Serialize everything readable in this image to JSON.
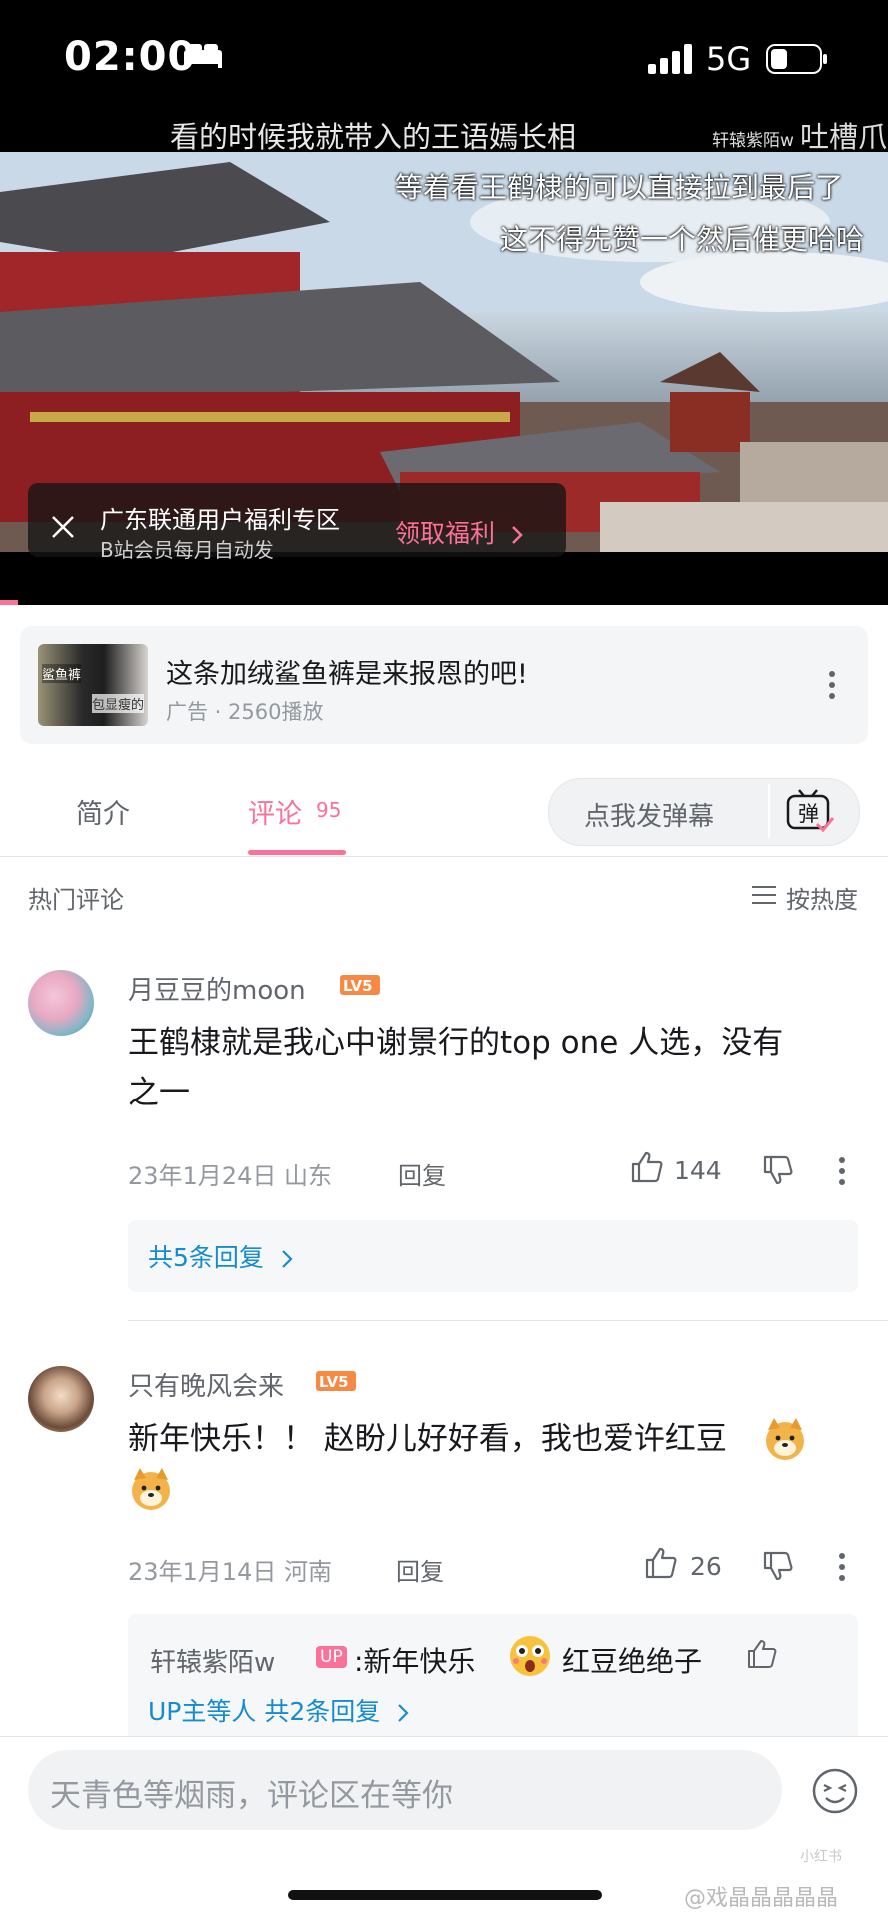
{
  "status_bar": {
    "time": "02:00",
    "network": "5G"
  },
  "video": {
    "danmaku": [
      "看的时候我就带入的王语嫣长相",
      "等着看王鹤棣的可以直接拉到最后了",
      "这不得先赞一个然后催更哈哈",
      "轩辕紫陌w",
      "吐槽爪"
    ],
    "promo": {
      "title": "广东联通用户福利专区",
      "subtitle": "B站会员每月自动发",
      "cta": "领取福利"
    }
  },
  "ad": {
    "thumb_text_1": "鲨鱼裤",
    "thumb_text_2": "包显瘦的",
    "title": "这条加绒鲨鱼裤是来报恩的吧!",
    "meta": "广告 · 2560播放"
  },
  "tabs": {
    "intro": "简介",
    "comments": "评论",
    "comments_count": "95",
    "danmaku_placeholder": "点我发弹幕",
    "danmaku_button": "弹"
  },
  "comments_section": {
    "title": "热门评论",
    "sort": "按热度"
  },
  "comments": [
    {
      "user": "月豆豆的moon",
      "level": "LV5",
      "text_line1": "王鹤棣就是我心中谢景行的top one 人选，没有",
      "text_line2": "之一",
      "date_location": "23年1月24日 山东",
      "reply": "回复",
      "likes": "144",
      "replies_link": "共5条回复"
    },
    {
      "user": "只有晚风会来",
      "level": "LV5",
      "text_line1": "新年快乐！！ 赵盼儿好好看，我也爱许红豆",
      "date_location": "23年1月14日 河南",
      "reply": "回复",
      "likes": "26",
      "sub_reply": {
        "user": "轩辕紫陌w",
        "badge": "UP",
        "text1": ":新年快乐",
        "text2": "红豆绝绝子"
      },
      "replies_link": "UP主等人 共2条回复"
    }
  ],
  "bottom": {
    "input_placeholder": "天青色等烟雨，评论区在等你",
    "watermark_small": "小红书",
    "watermark": "@戏晶晶晶晶晶"
  },
  "colors": {
    "accent_pink": "#fb7299",
    "link_blue": "#178bcf",
    "level_orange": "#f68a45"
  },
  "icons": [
    "sleep-icon",
    "signal-icon",
    "battery-icon",
    "close-icon",
    "chevron-right-icon",
    "more-vertical-icon",
    "danmaku-icon",
    "sort-icon",
    "thumb-up-icon",
    "thumb-down-icon",
    "emoji-icon"
  ]
}
